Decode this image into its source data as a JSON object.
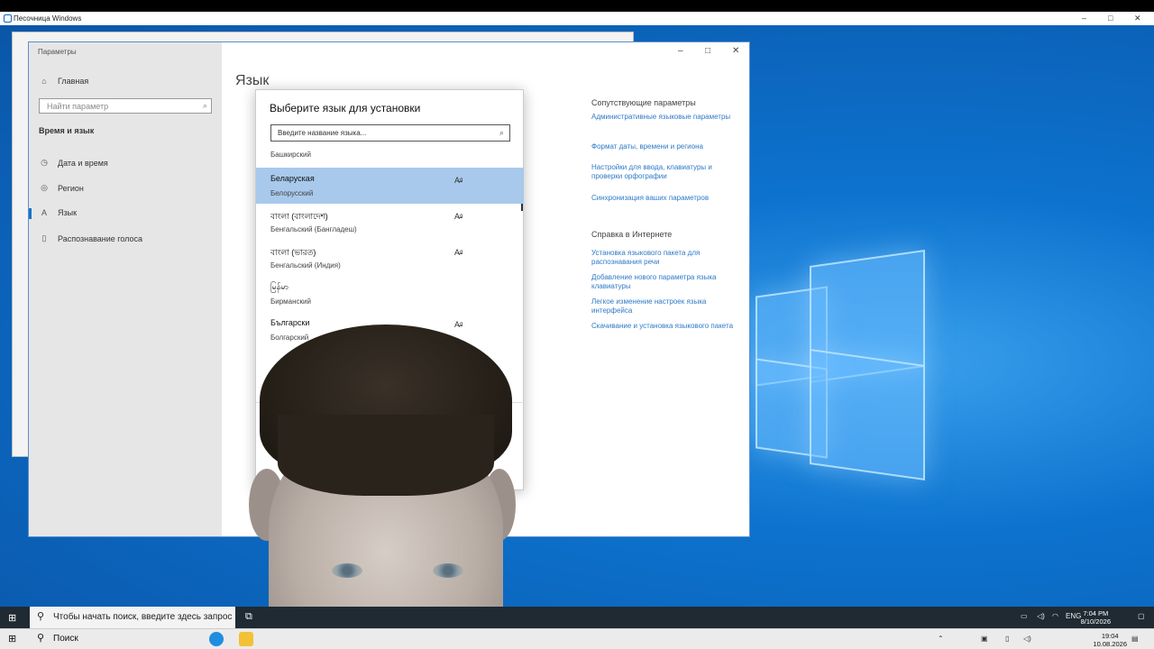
{
  "sandbox": {
    "title": "Песочница Windows",
    "controls": [
      "–",
      "□",
      "✕"
    ]
  },
  "settings": {
    "app_title": "Параметры",
    "controls": [
      "–",
      "□",
      "✕"
    ],
    "nav": {
      "home": "Главная",
      "search_placeholder": "Найти параметр",
      "group": "Время и язык",
      "items": [
        {
          "label": "Дата и время",
          "icon": "calendar-clock-icon"
        },
        {
          "label": "Регион",
          "icon": "globe-icon"
        },
        {
          "label": "Язык",
          "icon": "language-icon",
          "active": true
        },
        {
          "label": "Распознавание голоса",
          "icon": "microphone-icon"
        }
      ]
    },
    "page_title": "Язык",
    "related_title": "Сопутствующие параметры",
    "related_links": [
      "Административные языковые параметры",
      "Формат даты, времени и региона",
      "Настройки для ввода, клавиатуры и проверки орфографии",
      "Синхронизация ваших параметров"
    ],
    "help_title": "Справка в Интернете",
    "help_links": [
      "Установка языкового пакета для распознавания речи",
      "Добавление нового параметра языка клавиатуры",
      "Легкое изменение настроек языка интерфейса",
      "Скачивание и установка языкового пакета"
    ]
  },
  "dialog": {
    "title": "Выберите язык для установки",
    "search_placeholder": "Введите название языка...",
    "partial_item": "Башкирский",
    "languages": [
      {
        "native": "Беларуская",
        "russian": "Белорусский",
        "feature_icon": "text-to-speech-icon",
        "selected": true
      },
      {
        "native": "বাংলা (বাংলাদেশ)",
        "russian": "Бенгальский (Бангладеш)",
        "feature_icon": "text-to-speech-icon"
      },
      {
        "native": "বাংলা (ভারত)",
        "russian": "Бенгальский (Индия)",
        "feature_icon": "text-to-speech-icon"
      },
      {
        "native": "မြန်မာ",
        "russian": "Бирманский"
      },
      {
        "native": "Български",
        "russian": "Болгарский",
        "feature_icon": "text-to-speech-icon"
      }
    ]
  },
  "inner_taskbar": {
    "search_placeholder": "Чтобы начать поиск, введите здесь запрос",
    "lang": "ENG",
    "time": "7:04 PM",
    "date": "8/10/2026"
  },
  "host_taskbar": {
    "search_label": "Поиск",
    "time": "19:04",
    "date": "10.08.2026"
  },
  "colors": {
    "desktop": "#0d73cf",
    "selection": "#a8c9ec",
    "link": "#2f7ac8"
  }
}
